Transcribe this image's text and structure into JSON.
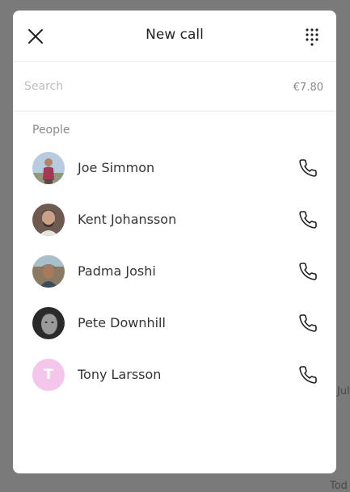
{
  "background": {
    "text_right_1": "Jul",
    "text_right_2": "Tod"
  },
  "header": {
    "title": "New call"
  },
  "search": {
    "placeholder": "Search",
    "value": "",
    "credit": "€7.80"
  },
  "people": {
    "label": "People",
    "contacts": [
      {
        "name": "Joe Simmon",
        "avatar": "photo"
      },
      {
        "name": "Kent Johansson",
        "avatar": "photo"
      },
      {
        "name": "Padma Joshi",
        "avatar": "photo"
      },
      {
        "name": "Pete Downhill",
        "avatar": "photo"
      },
      {
        "name": "Tony Larsson",
        "avatar": "initial",
        "initial": "T",
        "avatar_color": "#f5c6ec"
      }
    ]
  },
  "colors": {
    "overlay": "#7a7a7a",
    "accent_text": "#222222",
    "muted_text": "#8a8a8a"
  }
}
